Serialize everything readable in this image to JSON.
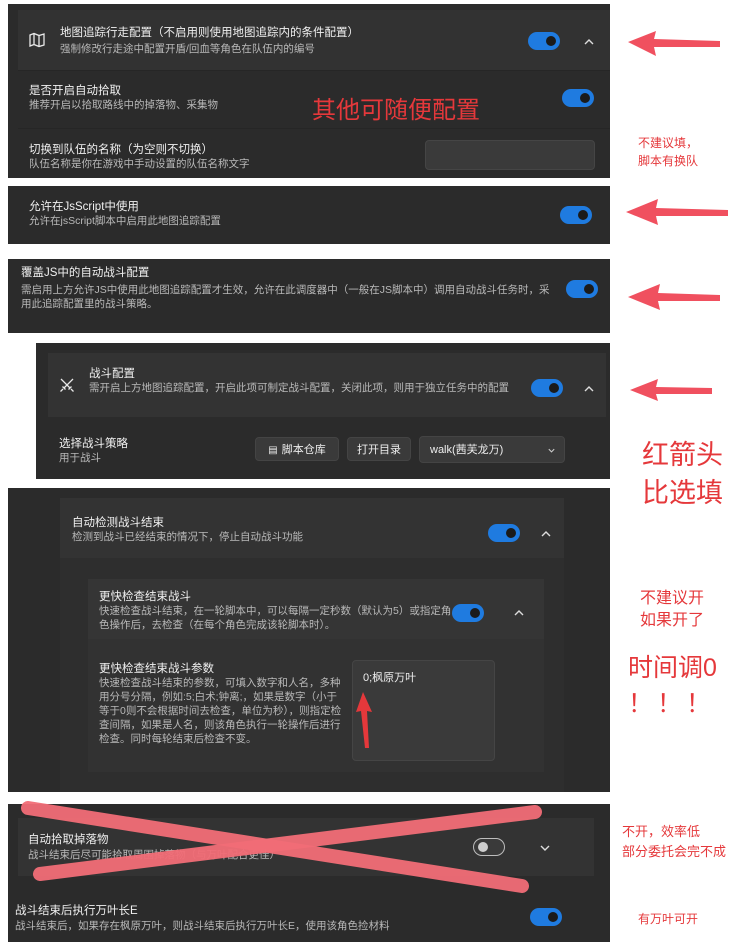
{
  "colors": {
    "accent": "#1f7be0",
    "annotation": "#e5383b",
    "panel": "#2b2b2b"
  },
  "map_tracking": {
    "title": "地图追踪行走配置（不启用则使用地图追踪内的条件配置）",
    "desc": "强制修改行走途中配置开盾/回血等角色在队伍内的编号",
    "icon": "map-icon",
    "toggle_on": true
  },
  "auto_pickup": {
    "title": "是否开启自动拾取",
    "desc": "推荐开启以拾取路线中的掉落物、采集物",
    "toggle_on": true
  },
  "team_switch": {
    "title": "切换到队伍的名称（为空则不切换）",
    "desc": "队伍名称是你在游戏中手动设置的队伍名称文字",
    "value": ""
  },
  "jsscript": {
    "title": "允许在JsScript中使用",
    "desc": "允许在jsScript脚本中启用此地图追踪配置",
    "toggle_on": true
  },
  "override_js": {
    "title": "覆盖JS中的自动战斗配置",
    "desc": "需启用上方允许JS中使用此地图追踪配置才生效，允许在此调度器中（一般在JS脚本中）调用自动战斗任务时，采用此追踪配置里的战斗策略。",
    "toggle_on": true
  },
  "combat_config": {
    "title": "战斗配置",
    "desc": "需开启上方地图追踪配置，开启此项可制定战斗配置，关闭此项，则用于独立任务中的配置",
    "icon": "crossed-swords-icon",
    "toggle_on": true
  },
  "strategy": {
    "title": "选择战斗策略",
    "desc": "用于战斗",
    "repo_button": "脚本仓库",
    "open_dir_button": "打开目录",
    "selected": "walk(茜芙龙万)"
  },
  "auto_detect_end": {
    "title": "自动检测战斗结束",
    "desc": "检测到战斗已经结束的情况下，停止自动战斗功能",
    "toggle_on": true
  },
  "fast_check": {
    "title": "更快检查结束战斗",
    "desc": "快速检查战斗结束，在一轮脚本中，可以每隔一定秒数（默认为5）或指定角色操作后，去检查（在每个角色完成该轮脚本时）。",
    "toggle_on": true
  },
  "fast_check_params": {
    "title": "更快检查结束战斗参数",
    "desc": "快速检查战斗结束的参数，可填入数字和人名，多种用分号分隔，例如:5;白术;钟离;，如果是数字（小于等于0则不会根据时间去检查，单位为秒），则指定检查间隔，如果是人名，则该角色执行一轮操作后进行检查。同时每轮结束后检查不变。",
    "value": "0;枫原万叶"
  },
  "pickup_drops": {
    "title": "自动拾取掉落物",
    "desc": "战斗结束后尽可能拾取周围掉落物（与万叶配合更佳）",
    "toggle_on": false
  },
  "wanye_e": {
    "title": "战斗结束后执行万叶长E",
    "desc": "战斗结束后，如果存在枫原万叶，则战斗结束后执行万叶长E，使用该角色捡材料",
    "toggle_on": true
  },
  "annotations": {
    "other_free": "其他可随便配置",
    "not_recommended_fill_1": "不建议填，",
    "not_recommended_fill_2": "脚本有换队",
    "red_arrow_1": "红箭头",
    "red_arrow_2": "比选填",
    "not_recommended_enable_1": "不建议开",
    "not_recommended_enable_2": "如果开了",
    "time_zero_1": "时间调0",
    "time_zero_2": "！！！",
    "dont_enable_1": "不开，效率低",
    "dont_enable_2": "部分委托会完不成",
    "wanye_enable": "有万叶可开"
  }
}
